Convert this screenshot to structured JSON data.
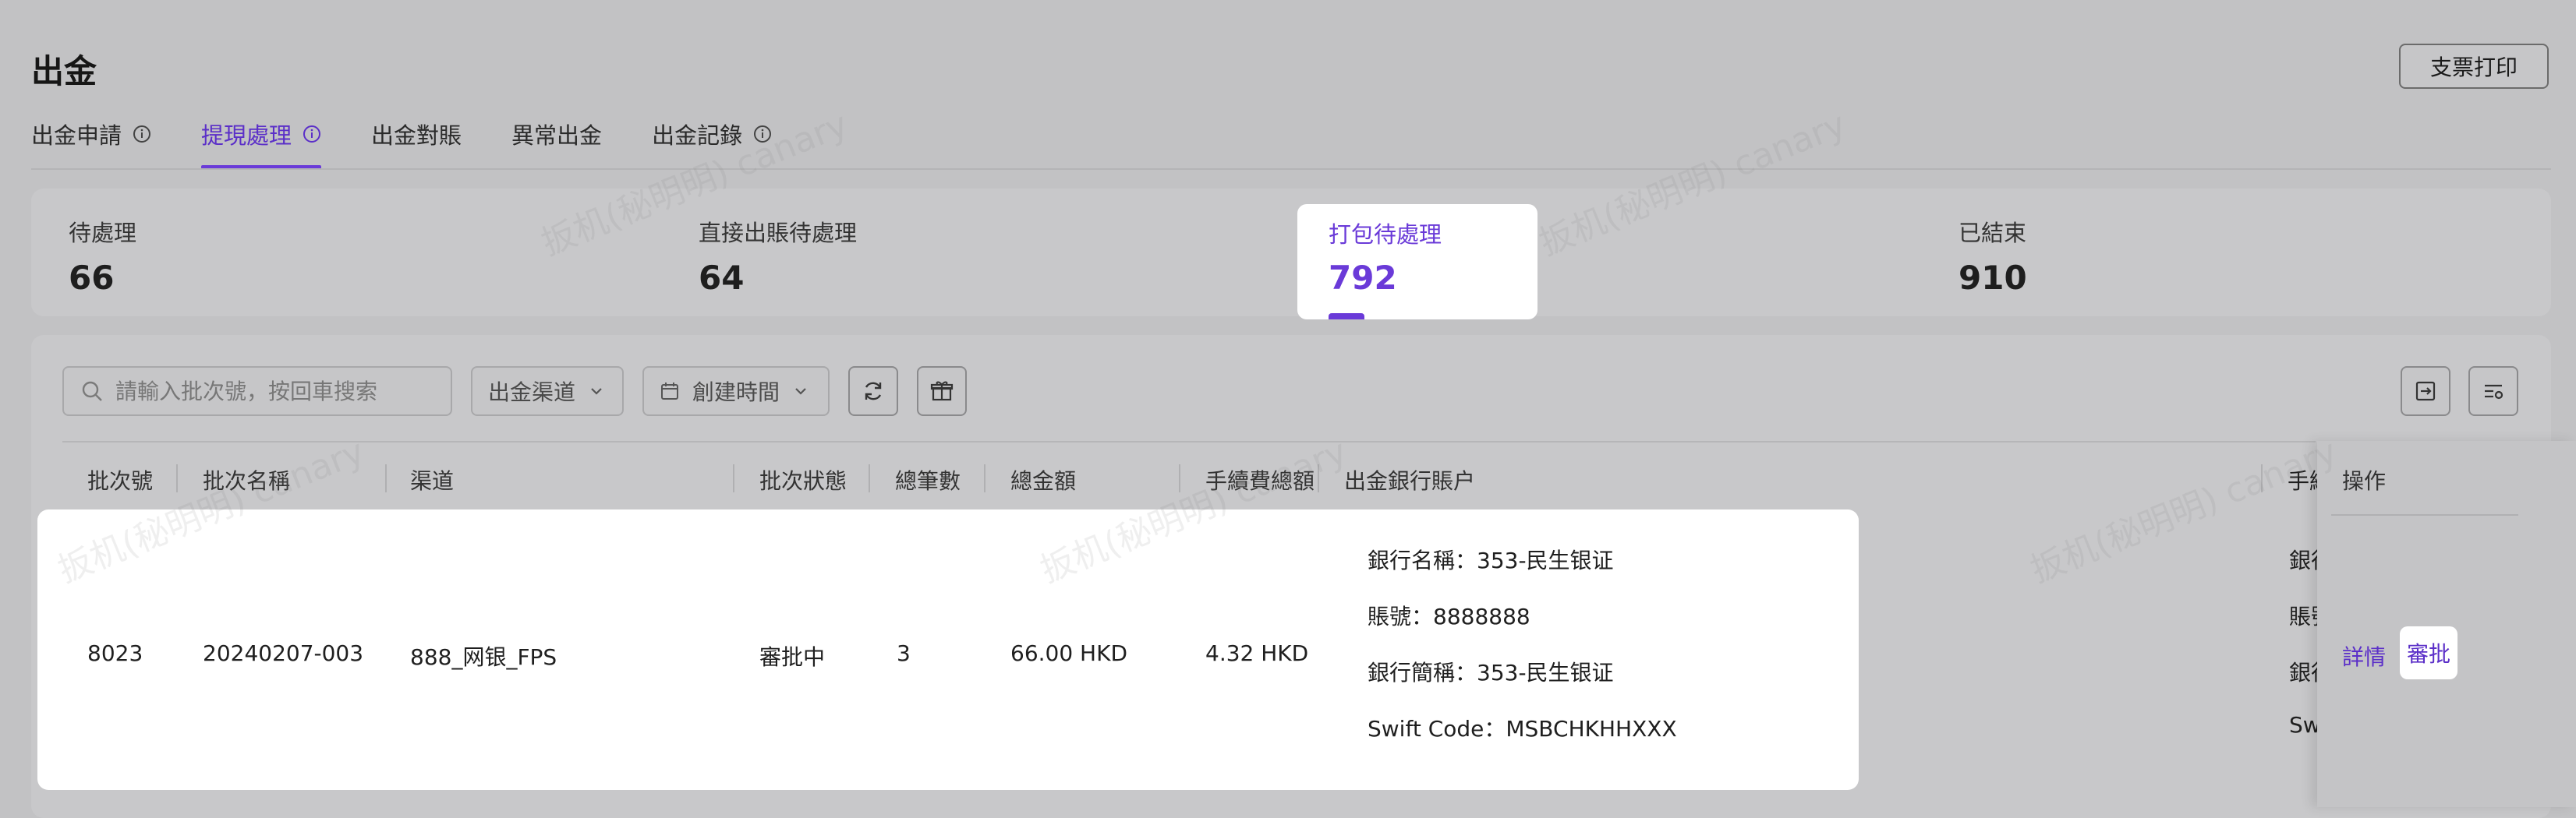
{
  "page": {
    "title": "出金",
    "print_button": "支票打印",
    "watermark": "扳机(秘明明) canary"
  },
  "tabs": [
    {
      "label": "出金申請",
      "has_info": true,
      "active": false
    },
    {
      "label": "提現處理",
      "has_info": true,
      "active": true
    },
    {
      "label": "出金對賬",
      "has_info": false,
      "active": false
    },
    {
      "label": "異常出金",
      "has_info": false,
      "active": false
    },
    {
      "label": "出金記錄",
      "has_info": true,
      "active": false
    }
  ],
  "stats": [
    {
      "label": "待處理",
      "value": "66"
    },
    {
      "label": "直接出賬待處理",
      "value": "64"
    },
    {
      "label": "打包待處理",
      "value": "792"
    },
    {
      "label": "已結束",
      "value": "910"
    }
  ],
  "toolbar": {
    "search_placeholder": "請輸入批次號，按回車搜索",
    "channel_filter": "出金渠道",
    "time_filter": "創建時間"
  },
  "table": {
    "columns": [
      "批次號",
      "批次名稱",
      "渠道",
      "批次狀態",
      "總筆數",
      "總金額",
      "手續費總額",
      "出金銀行賬户",
      "手續",
      "操作"
    ],
    "rows": [
      {
        "batch_no": "8023",
        "batch_name": "20240207-003",
        "channel": "888_网银_FPS",
        "status": "審批中",
        "count": "3",
        "total": "66.00 HKD",
        "fee": "4.32 HKD",
        "bank_lines": [
          "銀行名稱：353-民生银证",
          "賬號：8888888",
          "銀行簡稱：353-民生银证",
          "Swift Code：MSBCHKHHXXX"
        ],
        "fee_account_lines": [
          "銀行",
          "賬號",
          "銀行",
          "Swi"
        ],
        "actions": {
          "detail": "詳情",
          "approve": "審批"
        }
      }
    ]
  },
  "colors": {
    "accent": "#6a3ad8",
    "background_overlay": "#c2c2c4",
    "highlight": "#ffffff"
  }
}
